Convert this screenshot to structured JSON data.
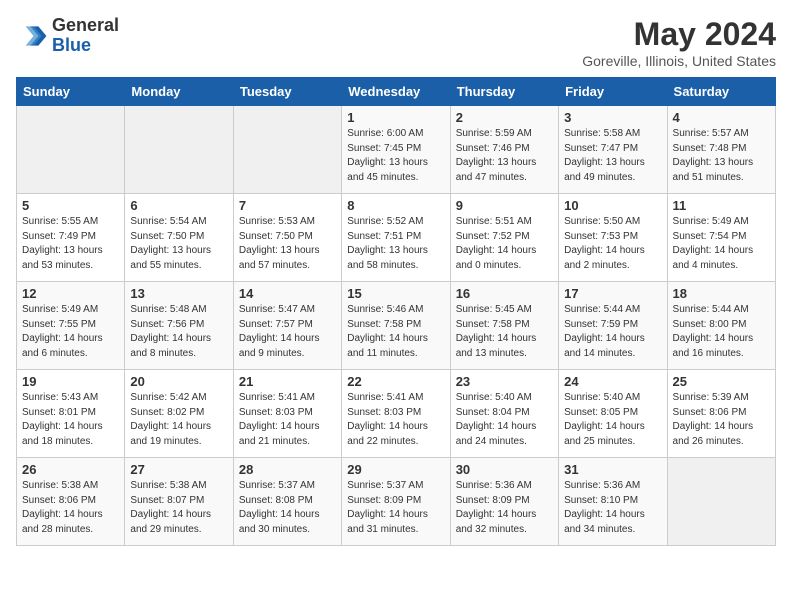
{
  "header": {
    "logo_line1": "General",
    "logo_line2": "Blue",
    "month": "May 2024",
    "location": "Goreville, Illinois, United States"
  },
  "columns": [
    "Sunday",
    "Monday",
    "Tuesday",
    "Wednesday",
    "Thursday",
    "Friday",
    "Saturday"
  ],
  "weeks": [
    [
      {
        "day": "",
        "info": ""
      },
      {
        "day": "",
        "info": ""
      },
      {
        "day": "",
        "info": ""
      },
      {
        "day": "1",
        "info": "Sunrise: 6:00 AM\nSunset: 7:45 PM\nDaylight: 13 hours\nand 45 minutes."
      },
      {
        "day": "2",
        "info": "Sunrise: 5:59 AM\nSunset: 7:46 PM\nDaylight: 13 hours\nand 47 minutes."
      },
      {
        "day": "3",
        "info": "Sunrise: 5:58 AM\nSunset: 7:47 PM\nDaylight: 13 hours\nand 49 minutes."
      },
      {
        "day": "4",
        "info": "Sunrise: 5:57 AM\nSunset: 7:48 PM\nDaylight: 13 hours\nand 51 minutes."
      }
    ],
    [
      {
        "day": "5",
        "info": "Sunrise: 5:55 AM\nSunset: 7:49 PM\nDaylight: 13 hours\nand 53 minutes."
      },
      {
        "day": "6",
        "info": "Sunrise: 5:54 AM\nSunset: 7:50 PM\nDaylight: 13 hours\nand 55 minutes."
      },
      {
        "day": "7",
        "info": "Sunrise: 5:53 AM\nSunset: 7:50 PM\nDaylight: 13 hours\nand 57 minutes."
      },
      {
        "day": "8",
        "info": "Sunrise: 5:52 AM\nSunset: 7:51 PM\nDaylight: 13 hours\nand 58 minutes."
      },
      {
        "day": "9",
        "info": "Sunrise: 5:51 AM\nSunset: 7:52 PM\nDaylight: 14 hours\nand 0 minutes."
      },
      {
        "day": "10",
        "info": "Sunrise: 5:50 AM\nSunset: 7:53 PM\nDaylight: 14 hours\nand 2 minutes."
      },
      {
        "day": "11",
        "info": "Sunrise: 5:49 AM\nSunset: 7:54 PM\nDaylight: 14 hours\nand 4 minutes."
      }
    ],
    [
      {
        "day": "12",
        "info": "Sunrise: 5:49 AM\nSunset: 7:55 PM\nDaylight: 14 hours\nand 6 minutes."
      },
      {
        "day": "13",
        "info": "Sunrise: 5:48 AM\nSunset: 7:56 PM\nDaylight: 14 hours\nand 8 minutes."
      },
      {
        "day": "14",
        "info": "Sunrise: 5:47 AM\nSunset: 7:57 PM\nDaylight: 14 hours\nand 9 minutes."
      },
      {
        "day": "15",
        "info": "Sunrise: 5:46 AM\nSunset: 7:58 PM\nDaylight: 14 hours\nand 11 minutes."
      },
      {
        "day": "16",
        "info": "Sunrise: 5:45 AM\nSunset: 7:58 PM\nDaylight: 14 hours\nand 13 minutes."
      },
      {
        "day": "17",
        "info": "Sunrise: 5:44 AM\nSunset: 7:59 PM\nDaylight: 14 hours\nand 14 minutes."
      },
      {
        "day": "18",
        "info": "Sunrise: 5:44 AM\nSunset: 8:00 PM\nDaylight: 14 hours\nand 16 minutes."
      }
    ],
    [
      {
        "day": "19",
        "info": "Sunrise: 5:43 AM\nSunset: 8:01 PM\nDaylight: 14 hours\nand 18 minutes."
      },
      {
        "day": "20",
        "info": "Sunrise: 5:42 AM\nSunset: 8:02 PM\nDaylight: 14 hours\nand 19 minutes."
      },
      {
        "day": "21",
        "info": "Sunrise: 5:41 AM\nSunset: 8:03 PM\nDaylight: 14 hours\nand 21 minutes."
      },
      {
        "day": "22",
        "info": "Sunrise: 5:41 AM\nSunset: 8:03 PM\nDaylight: 14 hours\nand 22 minutes."
      },
      {
        "day": "23",
        "info": "Sunrise: 5:40 AM\nSunset: 8:04 PM\nDaylight: 14 hours\nand 24 minutes."
      },
      {
        "day": "24",
        "info": "Sunrise: 5:40 AM\nSunset: 8:05 PM\nDaylight: 14 hours\nand 25 minutes."
      },
      {
        "day": "25",
        "info": "Sunrise: 5:39 AM\nSunset: 8:06 PM\nDaylight: 14 hours\nand 26 minutes."
      }
    ],
    [
      {
        "day": "26",
        "info": "Sunrise: 5:38 AM\nSunset: 8:06 PM\nDaylight: 14 hours\nand 28 minutes."
      },
      {
        "day": "27",
        "info": "Sunrise: 5:38 AM\nSunset: 8:07 PM\nDaylight: 14 hours\nand 29 minutes."
      },
      {
        "day": "28",
        "info": "Sunrise: 5:37 AM\nSunset: 8:08 PM\nDaylight: 14 hours\nand 30 minutes."
      },
      {
        "day": "29",
        "info": "Sunrise: 5:37 AM\nSunset: 8:09 PM\nDaylight: 14 hours\nand 31 minutes."
      },
      {
        "day": "30",
        "info": "Sunrise: 5:36 AM\nSunset: 8:09 PM\nDaylight: 14 hours\nand 32 minutes."
      },
      {
        "day": "31",
        "info": "Sunrise: 5:36 AM\nSunset: 8:10 PM\nDaylight: 14 hours\nand 34 minutes."
      },
      {
        "day": "",
        "info": ""
      }
    ]
  ]
}
